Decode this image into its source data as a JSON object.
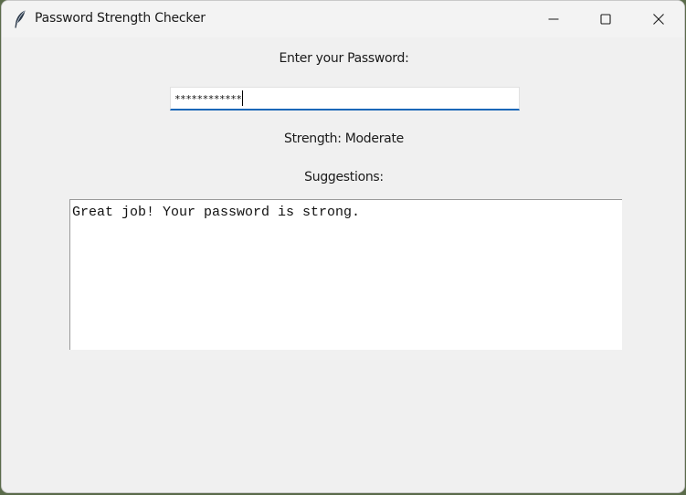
{
  "window": {
    "title": "Password Strength Checker",
    "icon": "feather-icon",
    "controls": [
      "minimize-icon",
      "maximize-icon",
      "close-icon"
    ]
  },
  "form": {
    "prompt_label": "Enter your Password:",
    "password_value": "************",
    "strength_text": "Strength: Moderate",
    "suggestions_label": "Suggestions:",
    "suggestions_text": "Great job! Your password is strong."
  },
  "colors": {
    "input_focus_underline": "#1a67b8",
    "window_bg": "#f0f0f0"
  }
}
